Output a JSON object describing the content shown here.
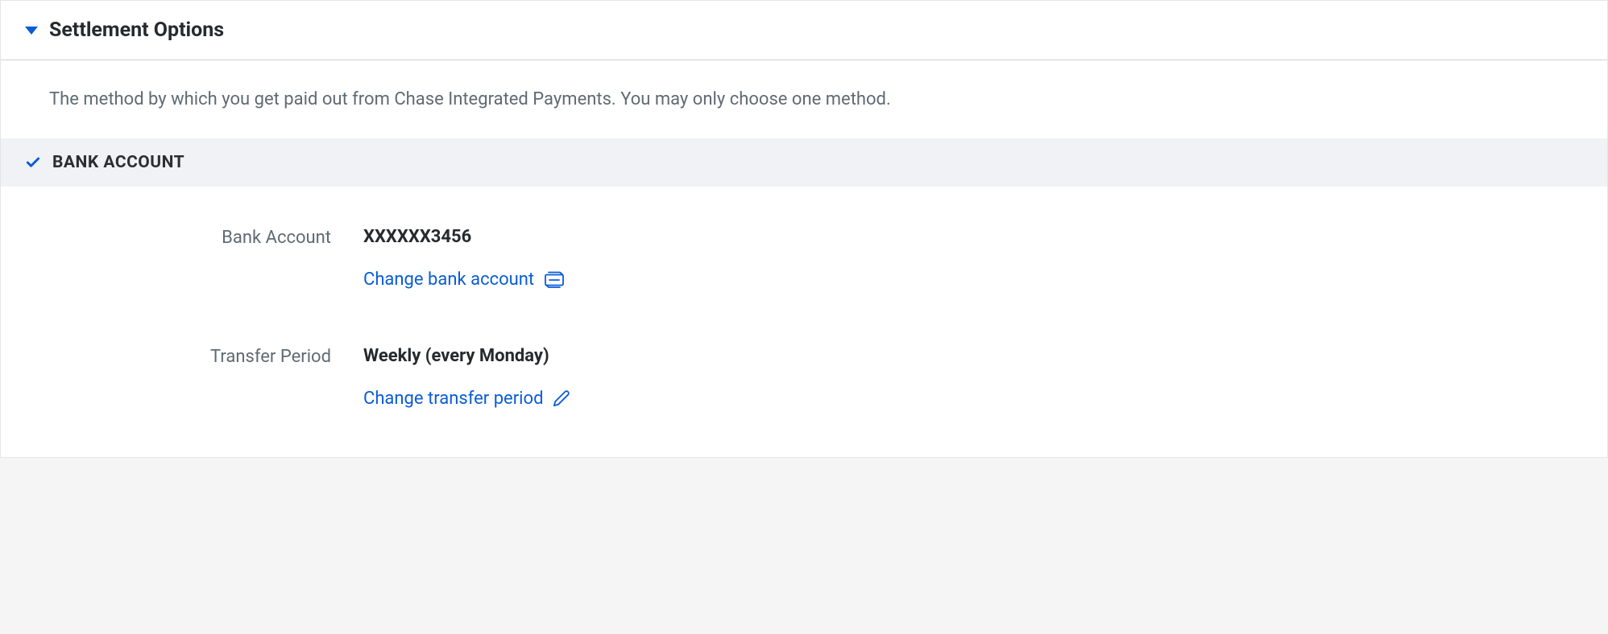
{
  "panel": {
    "title": "Settlement Options",
    "description": "The method by which you get paid out from Chase Integrated Payments. You may only choose one method."
  },
  "section": {
    "title": "BANK ACCOUNT"
  },
  "bank": {
    "label": "Bank Account",
    "value": "XXXXXX3456",
    "change_label": "Change bank account"
  },
  "transfer": {
    "label": "Transfer Period",
    "value": "Weekly (every Monday)",
    "change_label": "Change transfer period"
  },
  "colors": {
    "link": "#0b5cd6",
    "text_muted": "#606a73",
    "text_strong": "#262a2e",
    "section_bg": "#f0f2f5"
  }
}
